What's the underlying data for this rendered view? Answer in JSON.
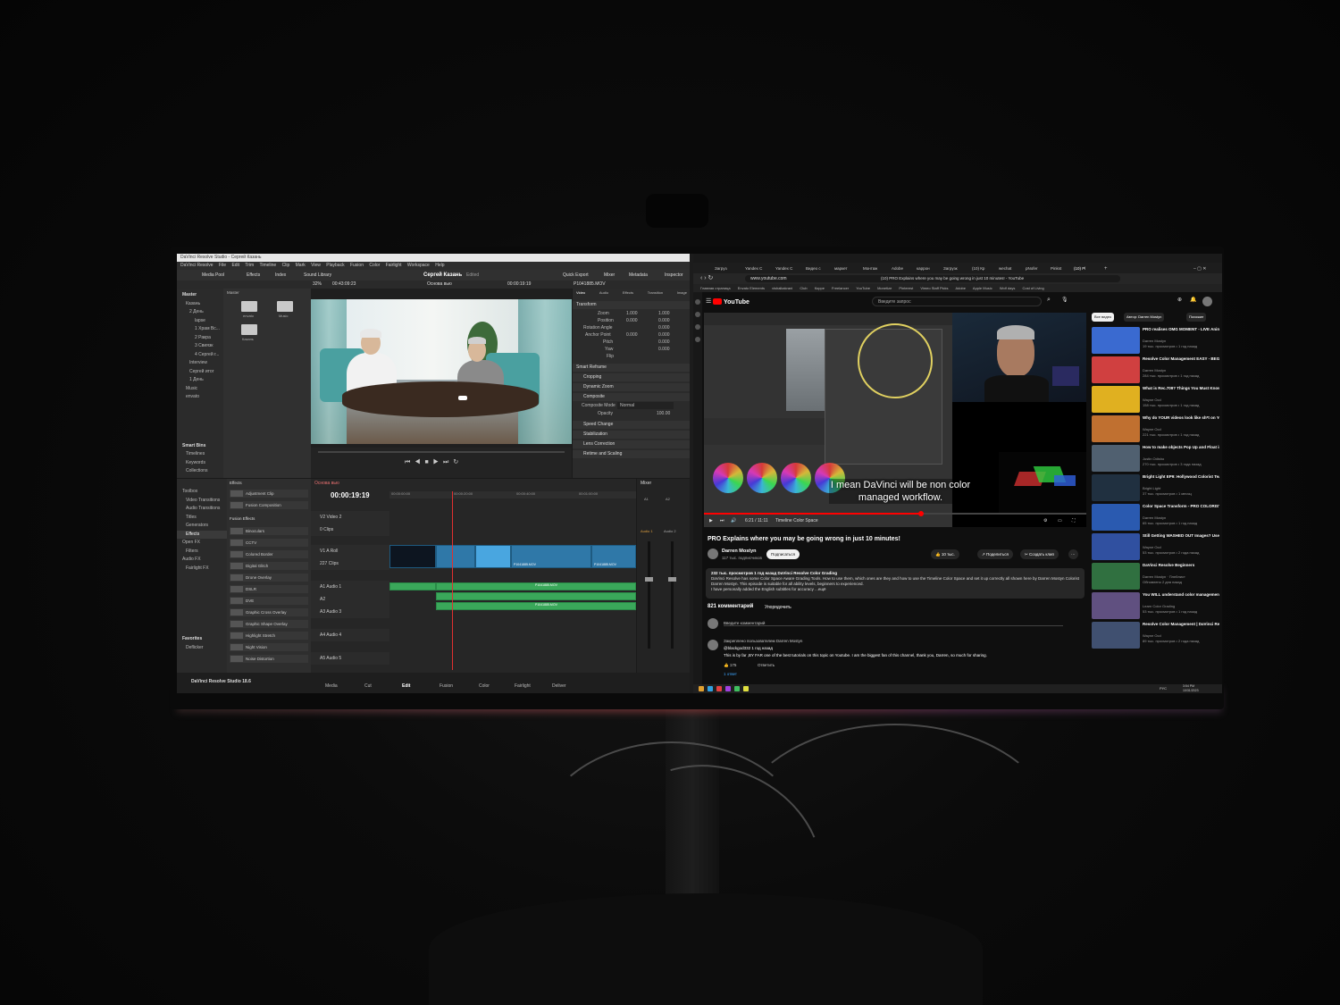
{
  "resolve": {
    "window_title": "DaVinci Resolve Studio - Сергей Казань",
    "menu": [
      "DaVinci Resolve",
      "File",
      "Edit",
      "Trim",
      "Timeline",
      "Clip",
      "Mark",
      "View",
      "Playback",
      "Fusion",
      "Color",
      "Fairlight",
      "Workspace",
      "Help"
    ],
    "toolbar": {
      "media_pool": "Media Pool",
      "effects": "Effects",
      "index": "Index",
      "sound_library": "Sound Library",
      "project": "Сергей Казань",
      "status": "Edited",
      "quick_export": "Quick Export",
      "mixer": "Mixer",
      "metadata": "Metadata",
      "inspector": "Inspector"
    },
    "sub": {
      "zoom": "32%",
      "timecode_left": "00:43:09:23",
      "timeline_name": "Основа вью",
      "timecode_right": "00:00:19:19",
      "clip_name": "P1041885.MOV"
    },
    "bins": [
      "Master",
      "Казань",
      "2 День",
      "lapse",
      "1 Храм Вс...",
      "2 Ракра",
      "3 Свиязк",
      "4 Сергей г...",
      "Interview",
      "Сергей итог",
      "1 День",
      "Music",
      "envato"
    ],
    "smart_bins_title": "Smart Bins",
    "smart_bins": [
      "Timelines",
      "Keywords",
      "Collections"
    ],
    "pool_header": "Master",
    "folders": [
      "envato",
      "Music",
      "Казань"
    ],
    "inspector": {
      "tabs": [
        "Video",
        "Audio",
        "Effects",
        "Transition",
        "Image"
      ],
      "transform": "Transform",
      "rows": [
        {
          "label": "Zoom",
          "x": "1.000",
          "y": "1.000"
        },
        {
          "label": "Position",
          "x": "0.000",
          "y": "0.000"
        },
        {
          "label": "Rotation Angle",
          "x": "0.000",
          "y": ""
        },
        {
          "label": "Anchor Point",
          "x": "0.000",
          "y": "0.000"
        },
        {
          "label": "Pitch",
          "x": "0.000",
          "y": ""
        },
        {
          "label": "Yaw",
          "x": "0.000",
          "y": ""
        },
        {
          "label": "Flip",
          "x": "",
          "y": ""
        }
      ],
      "sections_a": [
        "Smart Reframe",
        "Cropping",
        "Dynamic Zoom",
        "Composite"
      ],
      "composite_mode_label": "Composite Mode",
      "composite_mode": "Normal",
      "opacity_label": "Opacity",
      "opacity": "100.00",
      "sections_b": [
        "Speed Change",
        "Stabilization",
        "Lens Correction",
        "Retime and Scaling"
      ]
    },
    "toolbox": [
      "Toolbox",
      "Video Transitions",
      "Audio Transitions",
      "Titles",
      "Generators",
      "Effects",
      "Open FX",
      "Filters",
      "Audio FX",
      "Fairlight FX"
    ],
    "favorites_title": "Favorites",
    "favorites": [
      "Deflicker"
    ],
    "effects_title": "Effects",
    "effects_items": [
      "Adjustment Clip",
      "Fusion Composition"
    ],
    "fusion_effects_title": "Fusion Effects",
    "fusion_effects": [
      "Binoculars",
      "CCTV",
      "Colored Border",
      "Digital Glitch",
      "Drone Overlay",
      "DSLR",
      "DVE",
      "Graphic Cross Overlay",
      "Graphic Shape Overlay",
      "Highlight Stretch",
      "Night Vision",
      "Noise Distortion"
    ],
    "timeline": {
      "tab": "Основа вью",
      "timecode": "00:00:19:19",
      "ruler": [
        "00:00:00:00",
        "00:00:20:00",
        "00:00:40:00",
        "00:01:00:00"
      ],
      "tracks": [
        {
          "id": "V2",
          "name": "Video 2",
          "count": "0 Clips"
        },
        {
          "id": "V1",
          "name": "A Roll",
          "count": "227 Clips"
        },
        {
          "id": "A1",
          "name": "Audio 1",
          "count": "1.0"
        },
        {
          "id": "A2",
          "name": "",
          "count": ""
        },
        {
          "id": "A3",
          "name": "Audio 3",
          "count": "1.0"
        },
        {
          "id": "A4",
          "name": "Audio 4",
          "count": "1.0"
        },
        {
          "id": "A5",
          "name": "Audio 5",
          "count": "1.0"
        }
      ],
      "clips": [
        "P1041885.MOV",
        "P1041885.MOV",
        "P1041885.MOV",
        "P1041885.MOV"
      ]
    },
    "mixer_title": "Mixer",
    "mixer_channels": [
      "A1",
      "A2"
    ],
    "mixer_buses": [
      "Audio 1",
      "Audio 2"
    ],
    "brand": "DaVinci Resolve Studio 18.6",
    "pages": [
      "Media",
      "Cut",
      "Edit",
      "Fusion",
      "Color",
      "Fairlight",
      "Deliver"
    ]
  },
  "browser": {
    "tabs": [
      "Загруз",
      "Yandex C",
      "Yandex C",
      "Видео с",
      "маркет",
      "Монтаж",
      "Adobe",
      "каррон",
      "Загрузк",
      "(10) Кр",
      "wechat",
      "pNofer",
      "Pinkst",
      "(10) Pl"
    ],
    "window_title": "(10) PRO Explains where you may be going wrong in just 10 minutes! - YouTube",
    "url": "www.youtube.com",
    "bookmarks": [
      "Главная страница",
      "Envato Elements",
      "vishalkakrani",
      "Club",
      "Корре",
      "Freelancer",
      "YouTube",
      "Monetize",
      "Pinterest",
      "Vimeo Staff Picks",
      "Adobe",
      "Apple Music",
      "Wolf days",
      "Cost of Living"
    ],
    "youtube": {
      "logo": "YouTube",
      "search_placeholder": "Введите запрос",
      "caption": "I mean DaVinci will be non color managed workflow.",
      "time": "6:21 / 11:11",
      "chapter": "Timeline Color Space",
      "video_title": "PRO Explains where you may be going wrong in just 10 minutes!",
      "channel": "Darren Mostyn",
      "subscribers": "117 тыс. подписчиков",
      "subscribe": "Подписаться",
      "likes": "10 тыс.",
      "share": "Поделиться",
      "create_clip": "Создать клип",
      "desc_meta": "232 тыс. просмотров  1 год назад  DaVinci Resolve Color Grading",
      "desc_text": "DaVinci Resolve has some Color Space Aware Grading Tools. How to use them, which ones are they and how to use the Timeline Color Space and set it up correctly all shown here by Darren Mostyn Colorist Darren Mostyn. This episode is suitable for all ability levels, beginners to experienced.",
      "desc_more": "I have personally added the English subtitles for accuracy ...ещё",
      "comments_count": "821 комментарий",
      "sort": "Упорядочить",
      "add_comment": "Введите комментарий",
      "pinned": "Закреплено пользователем Darren Mostyn",
      "comment_author": "@blackgod332  1 год назад",
      "comment_text": "This is by far ,BY FAR one of the best tutorials on this topic on Youtube. I am the biggest fan of this channel, thank you, Darren, so much for sharing.",
      "comment_likes": "175",
      "reply": "Ответить",
      "replies": "1 ответ",
      "chips": [
        "Все видео",
        "Автор: Darren Mostyn",
        "Похожие"
      ],
      "recommendations": [
        {
          "title": "PRO realises OMG MOMENT - LIVE Animated Depth Map...",
          "channel": "Darren Mostyn",
          "meta": "19 тыс. просмотров • 1 год назад",
          "color": "#3a6ad0"
        },
        {
          "title": "Resolve Color Management EASY - BEGINNERS in under 5...",
          "channel": "Darren Mostyn",
          "meta": "284 тыс. просмотров • 1 год назад",
          "color": "#d04040"
        },
        {
          "title": "What is Rec.709? Things You Must Know!",
          "channel": "Wayne Ocd",
          "meta": "158 тыс. просмотров • 1 год назад",
          "color": "#e0b020"
        },
        {
          "title": "Why do YOUR videos look like sh*t on YouTube?",
          "channel": "Wayne Ocd",
          "meta": "221 тыс. просмотров • 1 год назад",
          "color": "#c07030"
        },
        {
          "title": "How to make objects Pop Up and Float in Adobe Premiere...",
          "channel": "Justin Odisho",
          "meta": "270 тыс. просмотров • 3 года назад",
          "color": "#506070"
        },
        {
          "title": "Bright Light EP9: Hollywood Colorist Teaches Color Theory...",
          "channel": "Bright Light",
          "meta": "37 тыс. просмотров • 1 месяц",
          "color": "#203040"
        },
        {
          "title": "Color Space Transform - PRO COLORIST Explains",
          "channel": "Darren Mostyn",
          "meta": "65 тыс. просмотров • 1 год назад",
          "color": "#2a5ab0"
        },
        {
          "title": "Still Getting WASHED OUT Images? Use These Export...",
          "channel": "Wayne Ocd",
          "meta": "53 тыс. просмотров • 2 года назад",
          "color": "#3050a0"
        },
        {
          "title": "DaVinci Resolve Beginners",
          "channel": "Darren Mostyn · Плейлист",
          "meta": "Обновлено 2 дня назад",
          "color": "#307040"
        },
        {
          "title": "You WILL understand color management! | Premiere...",
          "channel": "Learn Color Grading",
          "meta": "53 тыс. просмотров • 1 год назад",
          "color": "#605080"
        },
        {
          "title": "Resolve Color Management | DaVinci Resolve 17 Tutorial",
          "channel": "Wayne Ocd",
          "meta": "89 тыс. просмотров • 2 года назад",
          "color": "#405070"
        }
      ]
    },
    "taskbar": {
      "lang": "РУС",
      "time": "3:54 PM",
      "date": "10/31/2023"
    }
  }
}
